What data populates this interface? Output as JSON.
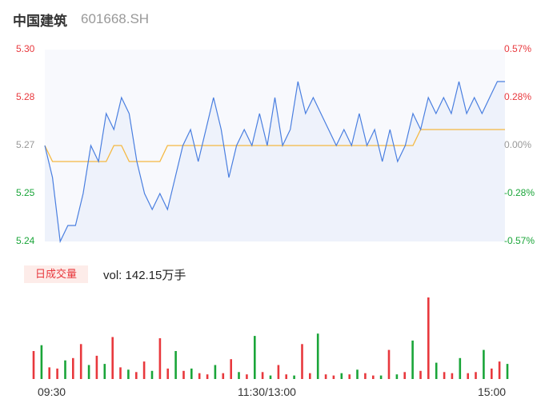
{
  "header": {
    "name": "中国建筑",
    "code": "601668.SH"
  },
  "volume_label": "日成交量",
  "volume_text": "vol: 142.15万手",
  "colors": {
    "price_line": "#4a7fe0",
    "avg_line": "#f5b942",
    "up": "#e8383d",
    "down": "#1aa539",
    "flat": "#999999"
  },
  "chart_data": [
    {
      "type": "line",
      "y_left_ticks": [
        "5.30",
        "5.28",
        "5.27",
        "5.25",
        "5.24"
      ],
      "y_right_ticks": [
        "0.57%",
        "0.28%",
        "0.00%",
        "-0.28%",
        "-0.57%"
      ],
      "x_ticks": [
        "09:30",
        "11:30/13:00",
        "15:00"
      ],
      "ylim": [
        5.24,
        5.3
      ],
      "x": [
        0,
        4,
        8,
        12,
        16,
        20,
        24,
        28,
        32,
        36,
        40,
        44,
        48,
        52,
        56,
        60,
        64,
        68,
        72,
        76,
        80,
        84,
        88,
        92,
        96,
        100,
        104,
        108,
        112,
        116,
        120,
        124,
        128,
        132,
        136,
        140,
        144,
        148,
        152,
        156,
        160,
        164,
        168,
        172,
        176,
        180,
        184,
        188,
        192,
        196,
        200,
        204,
        208,
        212,
        216,
        220,
        224,
        228,
        232,
        236,
        240
      ],
      "series": [
        {
          "values": [
            5.27,
            5.26,
            5.24,
            5.245,
            5.245,
            5.255,
            5.27,
            5.265,
            5.28,
            5.275,
            5.285,
            5.28,
            5.265,
            5.255,
            5.25,
            5.255,
            5.25,
            5.26,
            5.27,
            5.275,
            5.265,
            5.275,
            5.285,
            5.275,
            5.26,
            5.27,
            5.275,
            5.27,
            5.28,
            5.27,
            5.285,
            5.27,
            5.275,
            5.29,
            5.28,
            5.285,
            5.28,
            5.275,
            5.27,
            5.275,
            5.27,
            5.28,
            5.27,
            5.275,
            5.265,
            5.275,
            5.265,
            5.27,
            5.28,
            5.275,
            5.285,
            5.28,
            5.285,
            5.28,
            5.29,
            5.28,
            5.285,
            5.28,
            5.285,
            5.29,
            5.29
          ]
        },
        {
          "values": [
            5.27,
            5.265,
            5.265,
            5.265,
            5.265,
            5.265,
            5.265,
            5.265,
            5.265,
            5.27,
            5.27,
            5.265,
            5.265,
            5.265,
            5.265,
            5.265,
            5.27,
            5.27,
            5.27,
            5.27,
            5.27,
            5.27,
            5.27,
            5.27,
            5.27,
            5.27,
            5.27,
            5.27,
            5.27,
            5.27,
            5.27,
            5.27,
            5.27,
            5.27,
            5.27,
            5.27,
            5.27,
            5.27,
            5.27,
            5.27,
            5.27,
            5.27,
            5.27,
            5.27,
            5.27,
            5.27,
            5.27,
            5.27,
            5.27,
            5.275,
            5.275,
            5.275,
            5.275,
            5.275,
            5.275,
            5.275,
            5.275,
            5.275,
            5.275,
            5.275,
            5.275
          ]
        }
      ]
    },
    {
      "type": "bar",
      "x": [
        0,
        4,
        8,
        12,
        16,
        20,
        24,
        28,
        32,
        36,
        40,
        44,
        48,
        52,
        56,
        60,
        64,
        68,
        72,
        76,
        80,
        84,
        88,
        92,
        96,
        100,
        104,
        108,
        112,
        116,
        120,
        124,
        128,
        132,
        136,
        140,
        144,
        148,
        152,
        156,
        160,
        164,
        168,
        172,
        176,
        180,
        184,
        188,
        192,
        196,
        200,
        204,
        208,
        212,
        216,
        220,
        224,
        228,
        232,
        236,
        240
      ],
      "values": [
        2.4,
        2.9,
        1.0,
        0.9,
        1.6,
        1.8,
        3.0,
        1.2,
        2.0,
        1.3,
        3.6,
        1.0,
        0.8,
        0.6,
        1.5,
        0.7,
        3.5,
        0.9,
        2.4,
        0.7,
        0.9,
        0.5,
        0.4,
        1.2,
        0.5,
        1.7,
        0.6,
        0.4,
        3.7,
        0.6,
        0.3,
        1.2,
        0.4,
        0.3,
        3.0,
        0.5,
        3.9,
        0.4,
        0.3,
        0.5,
        0.4,
        0.8,
        0.5,
        0.3,
        0.3,
        2.5,
        0.4,
        0.6,
        3.3,
        0.7,
        7.0,
        1.4,
        0.6,
        0.5,
        1.8,
        0.5,
        0.6,
        2.5,
        0.9,
        1.5,
        1.3
      ],
      "colors": [
        "up",
        "down",
        "up",
        "up",
        "down",
        "up",
        "up",
        "down",
        "up",
        "down",
        "up",
        "up",
        "down",
        "up",
        "up",
        "down",
        "up",
        "up",
        "down",
        "up",
        "down",
        "up",
        "up",
        "down",
        "up",
        "up",
        "down",
        "up",
        "down",
        "up",
        "down",
        "up",
        "up",
        "down",
        "up",
        "up",
        "down",
        "up",
        "up",
        "down",
        "up",
        "down",
        "up",
        "up",
        "down",
        "up",
        "down",
        "up",
        "down",
        "up",
        "up",
        "down",
        "up",
        "up",
        "down",
        "up",
        "up",
        "down",
        "up",
        "up",
        "down"
      ]
    }
  ]
}
